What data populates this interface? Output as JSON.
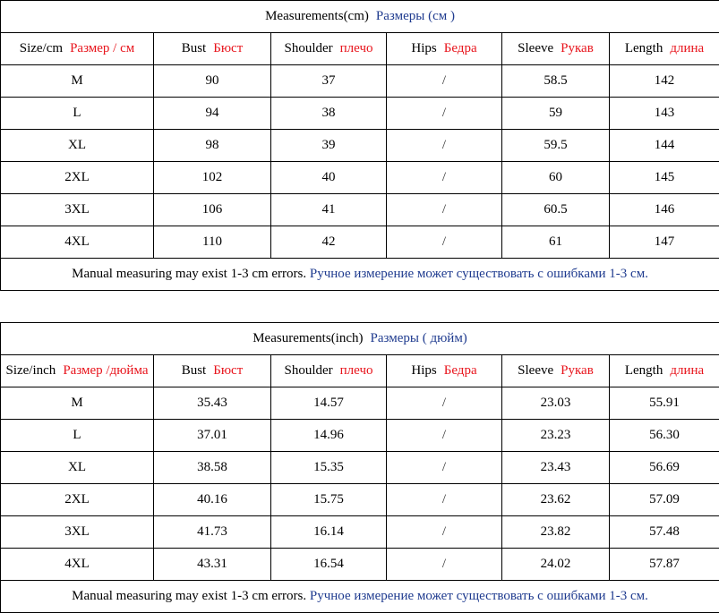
{
  "tables": [
    {
      "title_en": "Measurements(cm)",
      "title_ru": "Размеры (см )",
      "headers": [
        {
          "en": "Size/cm",
          "ru": "Размер / см"
        },
        {
          "en": "Bust",
          "ru": "Бюст"
        },
        {
          "en": "Shoulder",
          "ru": "плечо"
        },
        {
          "en": "Hips",
          "ru": "Бедра"
        },
        {
          "en": "Sleeve",
          "ru": "Рукав"
        },
        {
          "en": "Length",
          "ru": "длина"
        }
      ],
      "rows": [
        [
          "M",
          "90",
          "37",
          "/",
          "58.5",
          "142"
        ],
        [
          "L",
          "94",
          "38",
          "/",
          "59",
          "143"
        ],
        [
          "XL",
          "98",
          "39",
          "/",
          "59.5",
          "144"
        ],
        [
          "2XL",
          "102",
          "40",
          "/",
          "60",
          "145"
        ],
        [
          "3XL",
          "106",
          "41",
          "/",
          "60.5",
          "146"
        ],
        [
          "4XL",
          "110",
          "42",
          "/",
          "61",
          "147"
        ]
      ],
      "note_en": "Manual measuring may exist 1-3 cm errors.",
      "note_ru": "Ручное измерение может существовать с ошибками 1-3 см."
    },
    {
      "title_en": "Measurements(inch)",
      "title_ru": "Размеры ( дюйм)",
      "headers": [
        {
          "en": "Size/inch",
          "ru": "Размер /дюйма"
        },
        {
          "en": "Bust",
          "ru": "Бюст"
        },
        {
          "en": "Shoulder",
          "ru": "плечо"
        },
        {
          "en": "Hips",
          "ru": "Бедра"
        },
        {
          "en": "Sleeve",
          "ru": "Рукав"
        },
        {
          "en": "Length",
          "ru": "длина"
        }
      ],
      "rows": [
        [
          "M",
          "35.43",
          "14.57",
          "/",
          "23.03",
          "55.91"
        ],
        [
          "L",
          "37.01",
          "14.96",
          "/",
          "23.23",
          "56.30"
        ],
        [
          "XL",
          "38.58",
          "15.35",
          "/",
          "23.43",
          "56.69"
        ],
        [
          "2XL",
          "40.16",
          "15.75",
          "/",
          "23.62",
          "57.09"
        ],
        [
          "3XL",
          "41.73",
          "16.14",
          "/",
          "23.82",
          "57.48"
        ],
        [
          "4XL",
          "43.31",
          "16.54",
          "/",
          "24.02",
          "57.87"
        ]
      ],
      "note_en": "Manual measuring may exist 1-3 cm errors.",
      "note_ru": "Ручное измерение может существовать с ошибками 1-3 см."
    }
  ],
  "colors": {
    "russian_header": "#e8141c",
    "russian_title": "#1f3b8f",
    "text": "#000000",
    "border": "#000000"
  }
}
